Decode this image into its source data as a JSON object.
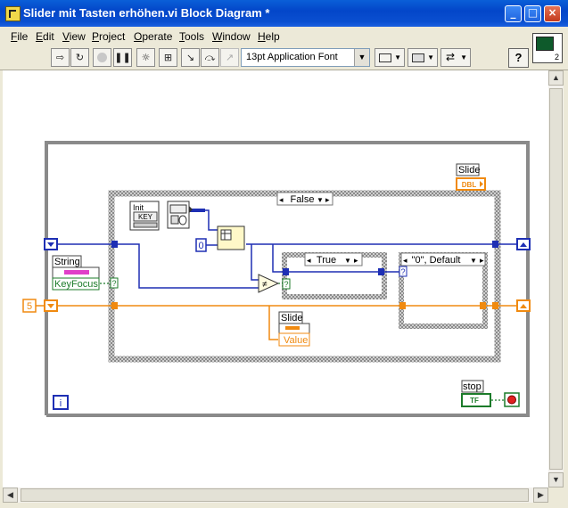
{
  "window": {
    "title": "Slider mit Tasten erhöhen.vi Block Diagram *",
    "buttons": {
      "minimize": "_",
      "maximize": "□",
      "close": "×"
    }
  },
  "menu": [
    "File",
    "Edit",
    "View",
    "Project",
    "Operate",
    "Tools",
    "Window",
    "Help"
  ],
  "toolbar": {
    "font": "13pt Application Font",
    "icons": [
      "run-arrow-icon",
      "run-continuously-icon",
      "abort-icon",
      "pause-icon",
      "highlight-execution-icon",
      "retain-wire-values-icon",
      "step-into-icon",
      "step-over-icon",
      "step-out-icon",
      "align-icon",
      "distribute-icon",
      "reorder-icon"
    ],
    "help": "?"
  },
  "vi_icon": {
    "connector": "2"
  },
  "diagram": {
    "case_outer": "False",
    "case_inner": "True",
    "case_right": "\"0\", Default",
    "init_key": [
      "Init",
      "KEY"
    ],
    "const_zero": "0",
    "const_five": "5",
    "string_label": "String",
    "keyfocus_label": "KeyFocus",
    "slide_terminal_label": "Slide",
    "slide_terminal_type": "DBL",
    "slide_property_label": "Slide",
    "slide_value_label": "Value",
    "stop_label": "stop",
    "stop_type": "TF",
    "iteration": "i",
    "question": "?"
  },
  "colors": {
    "bool_wire": "#1c7b2a",
    "numeric_wire": "#f08a10",
    "i32_wire": "#1e2fb4",
    "string_wire": "#e040c8",
    "frame": "#838383"
  }
}
